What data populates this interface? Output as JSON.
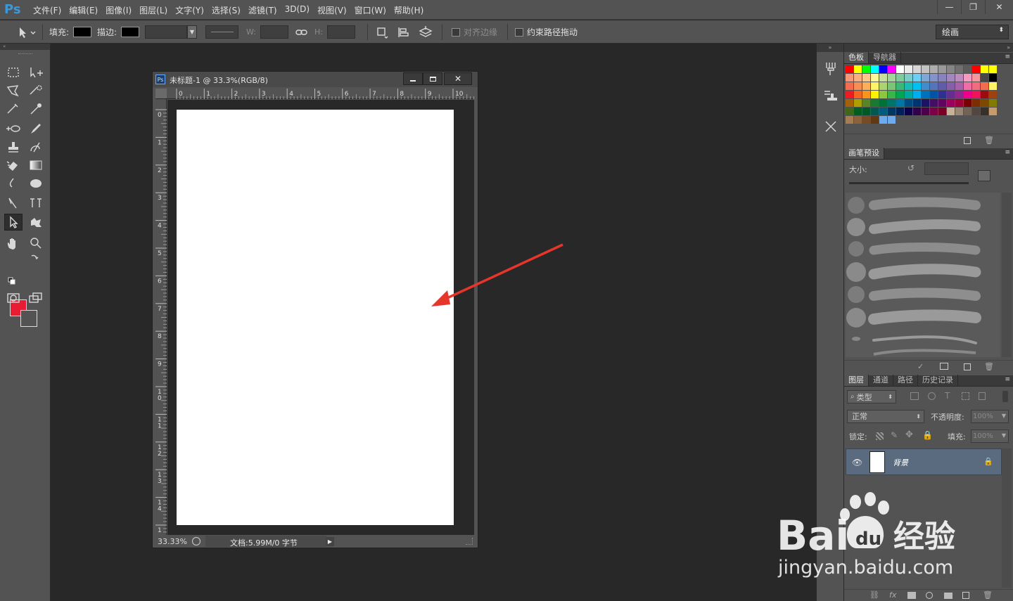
{
  "app": {
    "logo": "Ps"
  },
  "menu": [
    "文件(F)",
    "编辑(E)",
    "图像(I)",
    "图层(L)",
    "文字(Y)",
    "选择(S)",
    "滤镜(T)",
    "3D(D)",
    "视图(V)",
    "窗口(W)",
    "帮助(H)"
  ],
  "window_buttons": {
    "minimize": "—",
    "restore": "❐",
    "close": "✕"
  },
  "options": {
    "fill_label": "填充:",
    "stroke_label": "描边:",
    "w_label": "W:",
    "h_label": "H:",
    "align_edges": "对齐边缘",
    "constrain_path": "约束路径拖动",
    "workspace": "绘画"
  },
  "colors": {
    "foreground": "#e81c32",
    "background": "#535353",
    "accent": "#3d98d8",
    "annotation_arrow": "#e8352b",
    "layer_selected": "#5a6b80"
  },
  "document": {
    "icon": "Ps",
    "title": "未标题-1 @ 33.3%(RGB/8)",
    "zoom": "33.33%",
    "doc_info": "文档:5.99M/0 字节",
    "ruler_h": [
      "0",
      "1",
      "2",
      "3",
      "4",
      "5",
      "6",
      "7",
      "8",
      "9",
      "10"
    ],
    "ruler_v": [
      "0",
      "1",
      "2",
      "3",
      "4",
      "5",
      "6",
      "7",
      "8",
      "9",
      "1\n0",
      "1\n1",
      "1\n2",
      "1\n3",
      "1\n4",
      "1"
    ]
  },
  "panels": {
    "swatches_tabs": [
      "色板",
      "导航器"
    ],
    "brush_tab": "画笔预设",
    "brush_size_label": "大小:",
    "layer_tabs": [
      "图层",
      "通道",
      "路径",
      "历史记录"
    ],
    "filter_kind": "类型",
    "blend_mode": "正常",
    "opacity_label": "不透明度:",
    "opacity_value": "100%",
    "lock_label": "锁定:",
    "fill_label": "填充:",
    "fill_value": "100%",
    "layer_name": "背景"
  },
  "swatch_colors": [
    "#ff0000",
    "#ffff00",
    "#00ff00",
    "#00ffff",
    "#0000ff",
    "#ff00ff",
    "#ffffff",
    "#ebebeb",
    "#d6d6d6",
    "#c2c2c2",
    "#adadad",
    "#999999",
    "#858585",
    "#707070",
    "#5c5c5c",
    "#ff0000",
    "#ffff00",
    "#ffff00",
    "#f7977a",
    "#fbad82",
    "#fdc68c",
    "#fff799",
    "#c6df9c",
    "#a4d49d",
    "#81ca9d",
    "#7bcdc8",
    "#6ecff6",
    "#7ea7d8",
    "#8493ca",
    "#8882be",
    "#a187be",
    "#bc8cbf",
    "#f49bc1",
    "#f5989d",
    "#474747",
    "#000000",
    "#f26c4f",
    "#f68e55",
    "#fbaf5a",
    "#fff467",
    "#acd372",
    "#7cc576",
    "#3bb878",
    "#1abbb4",
    "#00bff3",
    "#438ccb",
    "#5574b9",
    "#605ca9",
    "#855fa8",
    "#a763a9",
    "#ef6ea8",
    "#f16d7e",
    "#f26c4f",
    "#fff467",
    "#ed1c24",
    "#f26522",
    "#f7941d",
    "#fff200",
    "#8dc63f",
    "#39b54a",
    "#00a651",
    "#00a99d",
    "#00aeef",
    "#0072bc",
    "#0054a5",
    "#2e3192",
    "#662d91",
    "#92278f",
    "#ec008c",
    "#ed145b",
    "#9e0b0f",
    "#a0410d",
    "#a3620a",
    "#aba000",
    "#598527",
    "#1a7b30",
    "#007236",
    "#00746b",
    "#0076a4",
    "#004a80",
    "#003471",
    "#1b1464",
    "#440e62",
    "#630460",
    "#9e005d",
    "#9e0039",
    "#790000",
    "#7b2e00",
    "#7d4900",
    "#827b00",
    "#406618",
    "#005e20",
    "#005826",
    "#005952",
    "#005b7f",
    "#003663",
    "#002157",
    "#0d004c",
    "#32004b",
    "#4b0049",
    "#7b0046",
    "#7a0026",
    "#c7b299",
    "#998675",
    "#736357",
    "#534741",
    "#37302a",
    "#c69c6d",
    "#a67c52",
    "#8c6239",
    "#754c24",
    "#603913",
    "#6dabf0",
    "#6dabf0"
  ]
}
